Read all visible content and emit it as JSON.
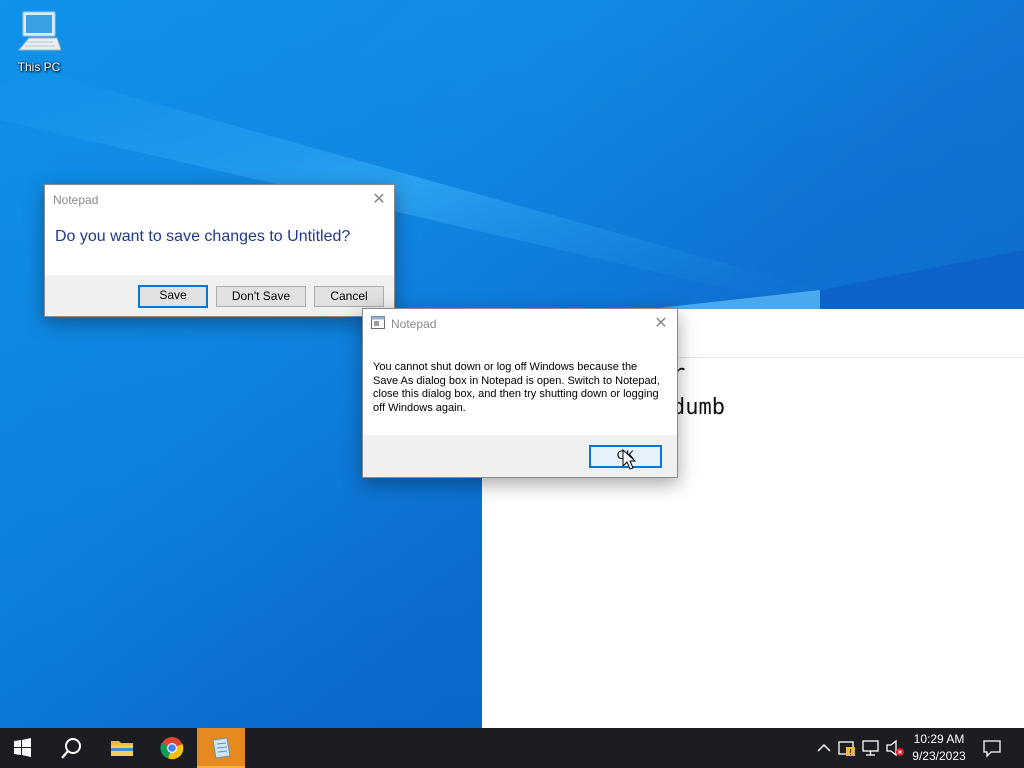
{
  "desktop": {
    "icons": [
      {
        "label": "This PC",
        "icon": "computer-icon"
      }
    ]
  },
  "notepad": {
    "lines": [
      "r",
      "dumb"
    ]
  },
  "save_dialog": {
    "title": "Notepad",
    "message": "Do you want to save changes to Untitled?",
    "buttons": {
      "save": "Save",
      "dont_save": "Don't Save",
      "cancel": "Cancel"
    }
  },
  "warning_dialog": {
    "title": "Notepad",
    "message": "You cannot shut down or log off Windows because the Save As dialog box in Notepad is open. Switch to Notepad, close this dialog box, and then try shutting down or logging off Windows again.",
    "ok_label": "OK"
  },
  "taskbar": {
    "buttons": [
      {
        "name": "start",
        "icon": "windows-logo-icon"
      },
      {
        "name": "search",
        "icon": "search-icon"
      },
      {
        "name": "file-explorer",
        "icon": "folder-icon"
      },
      {
        "name": "chrome",
        "icon": "chrome-icon"
      },
      {
        "name": "notepad",
        "icon": "notepad-icon",
        "active": true
      }
    ],
    "tray": {
      "icons": [
        "chevron-up-icon",
        "security-icon",
        "network-icon",
        "volume-muted-icon"
      ],
      "time": "10:29 AM",
      "date": "9/23/2023",
      "notification_icon": "notification-icon"
    }
  },
  "colors": {
    "accent": "#0078d7",
    "taskbar": "#1c1d22",
    "active_taskbar_button": "#e68a1f",
    "dialog_footer": "#f0f0f0",
    "save_prompt_text": "#1e3a8a"
  }
}
